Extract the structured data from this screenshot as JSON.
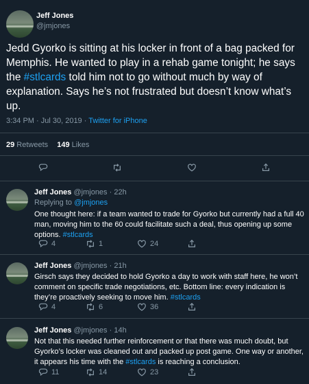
{
  "main": {
    "name": "Jeff Jones",
    "handle": "@jmjones",
    "text_pre": "Jedd Gyorko is sitting at his locker in front of a bag packed for Memphis. He wanted to play in a rehab game tonight; he says the ",
    "hashtag": "#stlcards",
    "text_post": " told him not to go without much by way of explanation. Says he’s not frustrated but doesn’t know what’s up.",
    "time": "3:34 PM · Jul 30, 2019",
    "sep": " · ",
    "source": "Twitter for iPhone",
    "retweets": "29",
    "retweets_label": " Retweets",
    "likes": "149",
    "likes_label": " Likes"
  },
  "replies": [
    {
      "name": "Jeff Jones",
      "handle": "@jmjones",
      "age": "22h",
      "replying_label": "Replying to ",
      "replying_to": "@jmjones",
      "text_pre": "One thought here: if a team wanted to trade for Gyorko but currently had a full 40 man, moving him to the 60 could facilitate such a deal, thus opening up some options. ",
      "hashtag": "#stlcards",
      "text_post": "",
      "reply_count": "4",
      "retweet_count": "1",
      "like_count": "24"
    },
    {
      "name": "Jeff Jones",
      "handle": "@jmjones",
      "age": "21h",
      "text_pre": "Girsch says they decided to hold Gyorko a day to work with staff here, he won’t comment on specific trade negotiations, etc. Bottom line: every indication is they’re proactively seeking to move him. ",
      "hashtag": "#stlcards",
      "text_post": "",
      "reply_count": "4",
      "retweet_count": "6",
      "like_count": "36"
    },
    {
      "name": "Jeff Jones",
      "handle": "@jmjones",
      "age": "14h",
      "text_pre": "Not that this needed further reinforcement or that there was much doubt, but Gyorko’s locker was cleaned out and packed up post game. One way or another, it appears his time with the ",
      "hashtag": "#stlcards",
      "text_post": " is reaching a conclusion.",
      "reply_count": "11",
      "retweet_count": "14",
      "like_count": "23"
    }
  ],
  "colors": {
    "background": "#15202b",
    "accent": "#1da1f2",
    "muted": "#8899a6",
    "divider": "#38444d"
  },
  "icons": [
    "reply-icon",
    "retweet-icon",
    "like-icon",
    "share-icon"
  ]
}
